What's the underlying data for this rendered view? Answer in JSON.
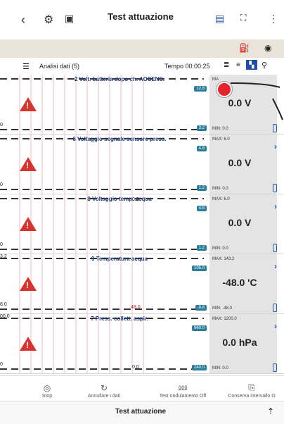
{
  "header": {
    "title": "Test attuazione"
  },
  "toolbar_secondary": {
    "left": "Analisi dati (5)",
    "time": "Tempo 00:00:25"
  },
  "rows": [
    {
      "name": "2 Volt. batteria dopo ch. ACCENS.",
      "top_tag": "12.8",
      "bottom_tag": "3.2",
      "max": "MA",
      "value": "0.0 V",
      "min": "MIN: 0.0"
    },
    {
      "name": "6 Voltaggio segnale sensore press.",
      "top_tag": "4.8",
      "bottom_tag": "1.2",
      "max": "MAX: 6.0",
      "value": "0.0 V",
      "min": "MIN: 0.0"
    },
    {
      "name": "8 Voltaggio temp. acqua",
      "top_tag": "4.8",
      "bottom_tag": "1.2",
      "max": "MAX: 6.0",
      "value": "0.0 V",
      "min": "MIN: 0.0"
    },
    {
      "name": "9 Temperatura acqua",
      "top_tag": "105.0",
      "bottom_tag": "-9.8",
      "max": "MAX: 143.2",
      "value": "-48.0 'C",
      "min": "MIN: -48.0"
    },
    {
      "name": "7 Press. collett. aspir.",
      "top_tag": "960.0",
      "bottom_tag": "240.0",
      "max": "MAX: 1200.0",
      "value": "0.0 hPa",
      "min": "MIN: 0.0"
    }
  ],
  "graph_labels": {
    "r1_left": "0",
    "r2_left": "0",
    "r3_left": "0",
    "r4_top": "3.2",
    "r4_left": "8.0",
    "r5_top": "00.0",
    "r5_left": "0",
    "r3_mid": "0.0",
    "r4_mid": "48.0",
    "r5_mid": "0.0"
  },
  "bottom_toolbar": {
    "stop": "Stop",
    "undo": "Annullare i dati",
    "wave": "Test ondulamento Off",
    "save": "Conserva intervallo O"
  },
  "bottom": {
    "title": "Test attuazione"
  }
}
